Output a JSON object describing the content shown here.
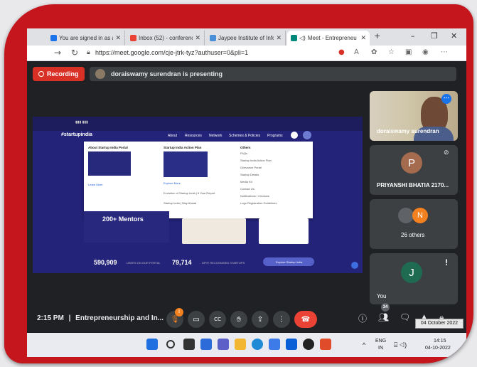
{
  "browser": {
    "tabs": [
      {
        "label": "You are signed in as an",
        "color": "#1a73e8"
      },
      {
        "label": "Inbox (52) - conference",
        "color": "#ea4335"
      },
      {
        "label": "Jaypee Institute of Info",
        "color": "#4a90d9"
      },
      {
        "label": "Meet - Entrepreneu",
        "color": "#00897b"
      }
    ],
    "new_tab": "+",
    "url": "https://meet.google.com/cje-jtrk-tyz?authuser=0&pli=1"
  },
  "meet": {
    "recording_label": "Recording",
    "presenting_text": "doraiswamy surendran is presenting",
    "clock": "2:15 PM",
    "separator": "|",
    "meeting_name": "Entrepreneurship and In...",
    "people_count": "34",
    "participants": [
      {
        "name": "doraiswamy surendran"
      },
      {
        "name": "PRIYANSHI BHATIA 2170...",
        "initial": "P",
        "color": "#a46b4f"
      },
      {
        "name": "26 others",
        "initial": "N",
        "color": "#f4811f"
      },
      {
        "name": "You",
        "initial": "J",
        "color": "#1e6b52"
      }
    ]
  },
  "slide": {
    "logo": "#startupindia",
    "menu": [
      "About",
      "Resources",
      "Network",
      "Schemes & Policies",
      "Programs"
    ],
    "dropdown": {
      "col1_title": "About Startup India Portal",
      "col1_link": "Learn More",
      "col2_title": "Startup India Action Plan",
      "col2_link": "Explore More",
      "col2_item1": "Evolution of Startup India | 6 Year Report",
      "col2_item2": "Startup India | Way Ahead",
      "col3_title": "Others",
      "col3_items": [
        "FAQs",
        "Startup India Action Plan",
        "Grievance Portal",
        "Startup Details",
        "Media Kit",
        "Contact Us",
        "Notifications / Circulars",
        "Logo Registration Guidelines"
      ]
    },
    "mentors": "200+ Mentors",
    "stat1": "590,909",
    "stat1_label": "USERS ON OUR PORTAL",
    "stat2": "79,714",
    "stat2_label": "DPIIT RECOGNISED STARTUPS",
    "explore_btn": "Explore Startup India"
  },
  "taskbar": {
    "lang1": "ENG",
    "lang2": "IN",
    "time": "14:15",
    "date": "04-10-2022",
    "date_tooltip": "04 October 2022"
  }
}
